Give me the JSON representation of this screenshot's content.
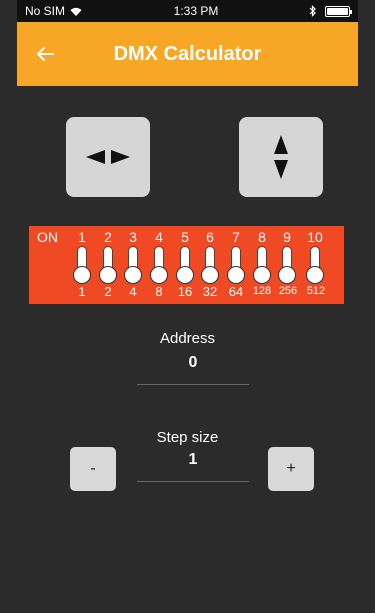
{
  "status_bar": {
    "carrier": "No SIM",
    "time": "1:33 PM",
    "icons": [
      "wifi-icon",
      "bluetooth-icon",
      "battery-icon"
    ]
  },
  "app_bar": {
    "title": "DMX Calculator",
    "back_icon": "arrow-left-icon",
    "color": "#f7a725"
  },
  "mode_buttons": [
    {
      "name": "horizontal-layout-button",
      "icon": "left-right-arrows-icon"
    },
    {
      "name": "vertical-layout-button",
      "icon": "up-down-arrows-icon"
    }
  ],
  "dip_switch": {
    "on_label": "ON",
    "panel_color": "#f04a24",
    "switches": [
      {
        "number": "1",
        "value": "1",
        "on": false
      },
      {
        "number": "2",
        "value": "2",
        "on": false
      },
      {
        "number": "3",
        "value": "4",
        "on": false
      },
      {
        "number": "4",
        "value": "8",
        "on": false
      },
      {
        "number": "5",
        "value": "16",
        "on": false
      },
      {
        "number": "6",
        "value": "32",
        "on": false
      },
      {
        "number": "7",
        "value": "64",
        "on": false
      },
      {
        "number": "8",
        "value": "128",
        "on": false
      },
      {
        "number": "9",
        "value": "256",
        "on": false
      },
      {
        "number": "10",
        "value": "512",
        "on": false
      }
    ]
  },
  "address": {
    "label": "Address",
    "value": "0"
  },
  "step": {
    "label": "Step size",
    "value": "1",
    "minus_label": "-",
    "plus_label": "+"
  }
}
